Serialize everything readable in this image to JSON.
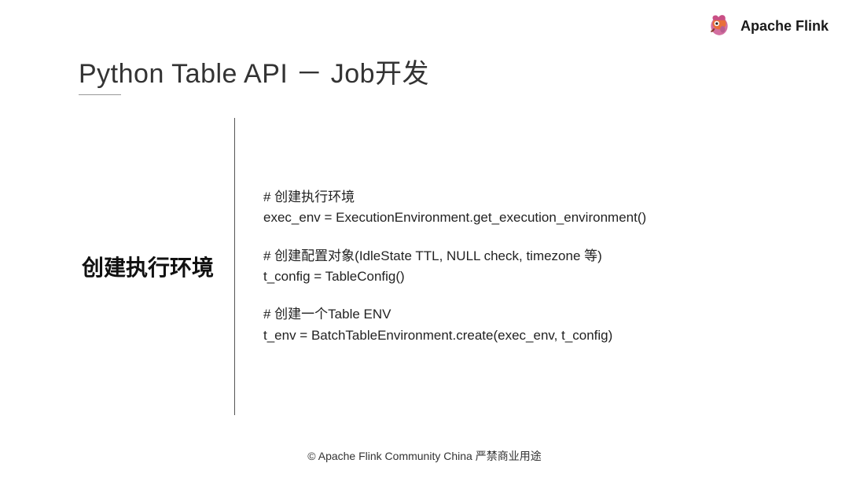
{
  "brand": {
    "name": "Apache Flink"
  },
  "title": "Python Table API － Job开发",
  "section_label": "创建执行环境",
  "code": {
    "comment1": "# 创建执行环境",
    "line1": "exec_env = ExecutionEnvironment.get_execution_environment()",
    "comment2": "# 创建配置对象(IdleState TTL, NULL check, timezone 等)",
    "line2": "t_config = TableConfig()",
    "comment3": "# 创建一个Table ENV",
    "line3": "t_env = BatchTableEnvironment.create(exec_env, t_config)"
  },
  "footer": "© Apache Flink Community China  严禁商业用途"
}
